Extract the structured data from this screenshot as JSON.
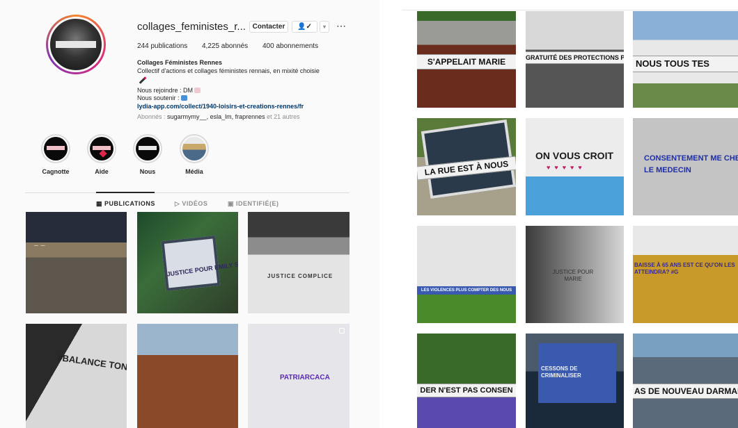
{
  "profile": {
    "username": "collages_feministes_r...",
    "contact_label": "Contacter",
    "follow_icon": "user-check-icon",
    "dropdown_icon": "chevron-down-icon",
    "more_icon": "⋯",
    "stats": {
      "publications": "244 publications",
      "followers": "4,225 abonnés",
      "following": "400 abonnements"
    },
    "bio": {
      "name": "Collages Féministes Rennes",
      "line1": "Collectif d'actions et collages féministes rennais, en mixité choisie",
      "line2": "Nous rejoindre : DM",
      "line3": "Nous soutenir :",
      "link": "lydia-app.com/collect/1940-loisirs-et-creations-rennes/fr",
      "followed_prefix": "Abonnés :",
      "followed_names": "sugarmymy__, esla_lm, fraprennes",
      "followed_suffix": "et 21 autres"
    }
  },
  "highlights": [
    {
      "label": "Cagnotte"
    },
    {
      "label": "Aide"
    },
    {
      "label": "Nous"
    },
    {
      "label": "Média"
    }
  ],
  "tabs": {
    "publications": "PUBLICATIONS",
    "videos": "VIDÉOS",
    "tagged": "IDENTIFIÉ(E)"
  },
  "left_posts": [
    {
      "text": "— —"
    },
    {
      "text": "JUSTICE POUR EMILY SPANTON"
    },
    {
      "text": "JUSTICE COMPLICE"
    },
    {
      "text": "#BALANCE TON BAR"
    },
    {
      "text": ""
    },
    {
      "text": "PATRIARCACA"
    }
  ],
  "right_posts": [
    {
      "text": "S'APPELAIT MARIE"
    },
    {
      "text": "GRATUITÉ DES PROTECTIONS PÉRIODIQUES"
    },
    {
      "text": "NOUS TOUS TES"
    },
    {
      "text": "LA RUE EST À NOUS"
    },
    {
      "text": "ON VOUS CROIT"
    },
    {
      "text": "CONSENTEMENT ME CHEZ LE MEDECIN"
    },
    {
      "text": "LES VIOLENCES PLUS COMPTER DES NOUS"
    },
    {
      "text": "JUSTICE POUR MARIE"
    },
    {
      "text": "BAISSE À 65 ANS EST CE QU'ON LES ATTEINDRA? #G"
    },
    {
      "text": "DER N'EST PAS CONSEN"
    },
    {
      "text": "CESSONS DE CRIMINALISER"
    },
    {
      "text": "AS DE NOUVEAU DARMAN"
    }
  ],
  "colors": {
    "accent_link": "#00376b",
    "secondary_text": "#8e8e8e",
    "border": "#dbdbdb"
  }
}
